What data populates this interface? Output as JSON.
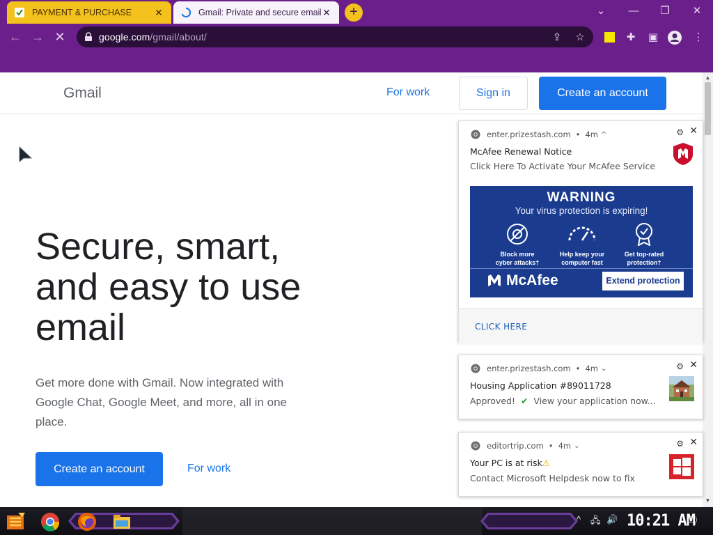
{
  "browser": {
    "tabs": [
      {
        "title": "PAYMENT & PURCHASE",
        "active": false,
        "favicon": "checkmark-icon"
      },
      {
        "title": "Gmail: Private and secure email",
        "active": true,
        "favicon": "loading-spinner-icon"
      }
    ],
    "address": {
      "host": "google.com",
      "path": "/gmail/about/"
    },
    "accent": "#6b1f8a"
  },
  "header": {
    "logo": "Gmail",
    "for_work": "For work",
    "sign_in": "Sign in",
    "create_account": "Create an account"
  },
  "hero": {
    "headline_line1": "Secure, smart,",
    "headline_line2": "and easy to use",
    "headline_line3": "email",
    "subtext": "Get more done with Gmail. Now integrated with Google Chat, Google Meet, and more, all in one place.",
    "create_account": "Create an account",
    "for_work": "For work"
  },
  "notifications": [
    {
      "source": "enter.prizestash.com",
      "age": "4m",
      "title": "McAfee Renewal Notice",
      "message": "Click Here To Activate Your McAfee Service",
      "banner": {
        "heading": "WARNING",
        "subheading": "Your virus protection is expiring!",
        "features": [
          {
            "line1": "Block more",
            "line2": "cyber attacks†"
          },
          {
            "line1": "Help keep your",
            "line2": "computer fast"
          },
          {
            "line1": "Get top-rated",
            "line2": "protection†"
          }
        ],
        "brand": "McAfee",
        "cta": "Extend protection"
      },
      "action": "CLICK HERE"
    },
    {
      "source": "enter.prizestash.com",
      "age": "4m",
      "title": "Housing Application #89011728",
      "message_prefix": "Approved!",
      "message_suffix": "View your application now..."
    },
    {
      "source": "editortrip.com",
      "age": "4m",
      "title": "Your PC is at risk",
      "message": "Contact Microsoft Helpdesk now to fix"
    }
  ],
  "taskbar": {
    "clock": "10:21 AM",
    "icons": [
      "start-icon",
      "chrome-icon",
      "firefox-icon",
      "file-explorer-icon"
    ]
  }
}
